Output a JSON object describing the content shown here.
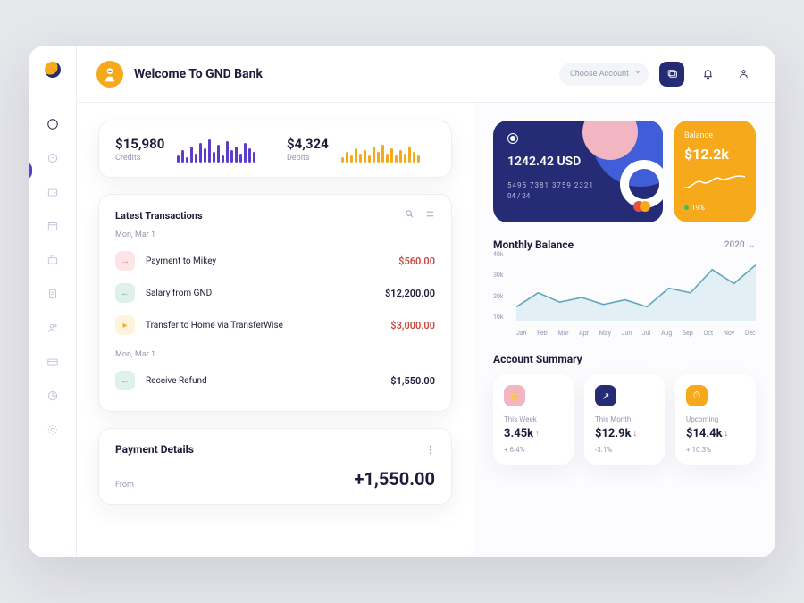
{
  "header": {
    "welcome": "Welcome To GND Bank",
    "account_selector": "Choose Account"
  },
  "sidebar": {
    "items": [
      "dashboard",
      "speed",
      "wallet",
      "calendar",
      "briefcase",
      "receipt",
      "users",
      "card",
      "chart",
      "settings"
    ]
  },
  "stats": {
    "credits": {
      "value": "$15,980",
      "label": "Credits"
    },
    "debits": {
      "value": "$4,324",
      "label": "Debits"
    }
  },
  "transactions": {
    "title": "Latest Transactions",
    "groups": [
      {
        "date": "Mon, Mar 1",
        "items": [
          {
            "icon": "out",
            "iconBg": "pink",
            "title": "Payment to Mikey",
            "amount": "$560.00",
            "tone": "red"
          },
          {
            "icon": "in",
            "iconBg": "green",
            "title": "Salary from GND",
            "amount": "$12,200.00",
            "tone": "ink"
          },
          {
            "icon": "play",
            "iconBg": "yellow",
            "title": "Transfer to Home via TransferWise",
            "amount": "$3,000.00",
            "tone": "red"
          }
        ]
      },
      {
        "date": "Mon, Mar 1",
        "items": [
          {
            "icon": "in",
            "iconBg": "green",
            "title": "Receive Refund",
            "amount": "$1,550.00",
            "tone": "ink"
          }
        ]
      }
    ]
  },
  "payment": {
    "title": "Payment Details",
    "from_label": "From",
    "amount": "+1,550.00"
  },
  "card": {
    "amount": "1242.42 USD",
    "number": "5495 7381 3759 2321",
    "exp": "04 / 24"
  },
  "balance": {
    "label": "Balance",
    "value": "$12.2k",
    "delta": "19%"
  },
  "monthly": {
    "title": "Monthly Balance",
    "year": "2020"
  },
  "summary": {
    "title": "Account Summary",
    "items": [
      {
        "label": "This Week",
        "value": "3.45k",
        "delta": "+ 6.4%",
        "dir": "up",
        "iconBg": "#f2b6c2"
      },
      {
        "label": "This Month",
        "value": "$12.9k",
        "delta": "-3.1%",
        "dir": "down",
        "iconBg": "#252c75"
      },
      {
        "label": "Upcoming",
        "value": "$14.4k",
        "delta": "+ 10.3%",
        "dir": "down",
        "iconBg": "#f6a91b"
      }
    ]
  },
  "chart_data": {
    "type": "line",
    "title": "Monthly Balance",
    "xlabel": "",
    "ylabel": "",
    "ylim": [
      10000,
      40000
    ],
    "yticks": [
      "40k",
      "30k",
      "20k",
      "10k"
    ],
    "categories": [
      "Jan",
      "Feb",
      "Mar",
      "Apr",
      "May",
      "Jun",
      "Jul",
      "Aug",
      "Sep",
      "Oct",
      "Nov",
      "Dec"
    ],
    "values": [
      16000,
      22000,
      18000,
      20000,
      17000,
      19000,
      16000,
      24000,
      22000,
      32000,
      26000,
      34000
    ]
  },
  "bars_data": {
    "credits": [
      8,
      14,
      6,
      18,
      10,
      22,
      16,
      26,
      12,
      20,
      8,
      24,
      14,
      18,
      10,
      22,
      16,
      12
    ],
    "debits": [
      6,
      12,
      8,
      16,
      10,
      14,
      8,
      18,
      12,
      20,
      10,
      16,
      8,
      14,
      10,
      18,
      12,
      8
    ]
  }
}
